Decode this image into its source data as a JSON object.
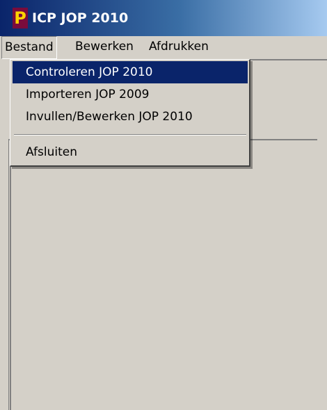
{
  "titlebar": {
    "icon_glyph": "P",
    "title": "ICP JOP 2010"
  },
  "menubar": {
    "items": [
      {
        "label": "Bestand"
      },
      {
        "label": "Bewerken"
      },
      {
        "label": "Afdrukken"
      }
    ]
  },
  "dropdown": {
    "items": [
      {
        "label": "Controleren JOP 2010"
      },
      {
        "label": "Importeren JOP 2009"
      },
      {
        "label": "Invullen/Bewerken JOP 2010"
      },
      {
        "label": "Afsluiten"
      }
    ]
  },
  "colors": {
    "titlebar_start": "#0a246a",
    "titlebar_end": "#a6caf0",
    "highlight": "#0a246a",
    "surface": "#d4d0c8",
    "icon_bg": "#7a0c3c",
    "icon_fg": "#ffd400"
  }
}
